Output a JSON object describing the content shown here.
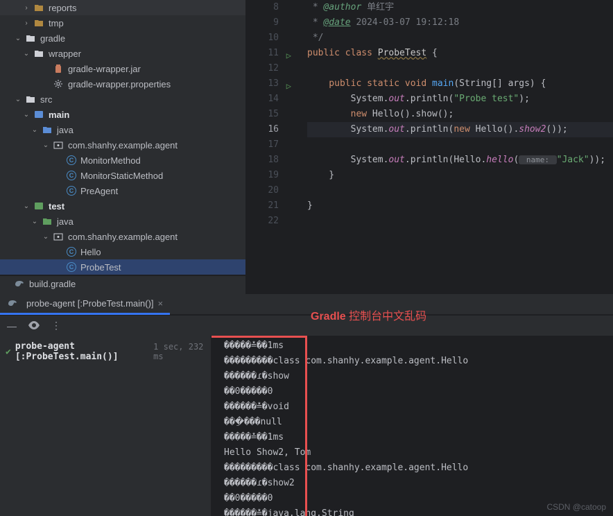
{
  "tree": {
    "reports": "reports",
    "tmp": "tmp",
    "gradle": "gradle",
    "wrapper": "wrapper",
    "jar": "gradle-wrapper.jar",
    "props": "gradle-wrapper.properties",
    "src": "src",
    "main": "main",
    "java": "java",
    "pkg": "com.shanhy.example.agent",
    "c1": "MonitorMethod",
    "c2": "MonitorStaticMethod",
    "c3": "PreAgent",
    "test": "test",
    "hello": "Hello",
    "probe": "ProbeTest",
    "buildgradle": "build.gradle"
  },
  "tab": {
    "label": "probe-agent [:ProbeTest.main()]"
  },
  "annotation": {
    "bold": "Gradle",
    "rest": " 控制台中文乱码"
  },
  "task": {
    "label": "probe-agent [:ProbeTest.main()]",
    "time": "1 sec, 232 ms"
  },
  "code": {
    "l8_star": " * ",
    "l8_tag": "@author",
    "l8_rest": " 单红宇",
    "l9_star": " * ",
    "l9_tag": "@date",
    "l9_rest": " 2024-03-07 19:12:18",
    "l10": " */",
    "l11_public": "public class ",
    "l11_cls": "ProbeTest",
    "l11_brace": " {",
    "l13_a": "    public static void ",
    "l13_main": "main",
    "l13_b": "(",
    "l13_str": "String",
    "l13_c": "[] ",
    "l13_args": "args",
    "l13_d": ") {",
    "l14_a": "        System.",
    "l14_out": "out",
    "l14_b": ".println(",
    "l14_str": "\"Probe test\"",
    "l14_c": ");",
    "l15_a": "        new ",
    "l15_b": "Hello().show();",
    "l16_a": "        System.",
    "l16_out": "out",
    "l16_b": ".println(",
    "l16_new": "new ",
    "l16_c": "Hello().",
    "l16_show2": "show2",
    "l16_d": "());",
    "l18_a": "        System.",
    "l18_out": "out",
    "l18_b": ".println(Hello.",
    "l18_hello": "hello",
    "l18_c": "(",
    "l18_hint": " name: ",
    "l18_str": "\"Jack\"",
    "l18_d": "));",
    "l19": "    }",
    "l21": "}"
  },
  "gutter": {
    "n8": "8",
    "n9": "9",
    "n10": "10",
    "n11": "11",
    "n12": "12",
    "n13": "13",
    "n14": "14",
    "n15": "15",
    "n16": "16",
    "n17": "17",
    "n18": "18",
    "n19": "19",
    "n20": "20",
    "n21": "21",
    "n22": "22"
  },
  "console": {
    "l1": "�����≛��1ms",
    "l2": "���������class com.shanhy.example.agent.Hello",
    "l3": "������ɾ�show",
    "l4": "��0�����0",
    "l5": "������≛�void",
    "l6": "���ֵ���null",
    "l7": "�����≛��1ms",
    "l8": "Hello Show2, Tom",
    "l9": "���������class com.shanhy.example.agent.Hello",
    "l10": "������ɾ�show2",
    "l11": "��0�����0",
    "l12": "������≛�java.lang.String"
  },
  "watermark": "CSDN @catoop"
}
